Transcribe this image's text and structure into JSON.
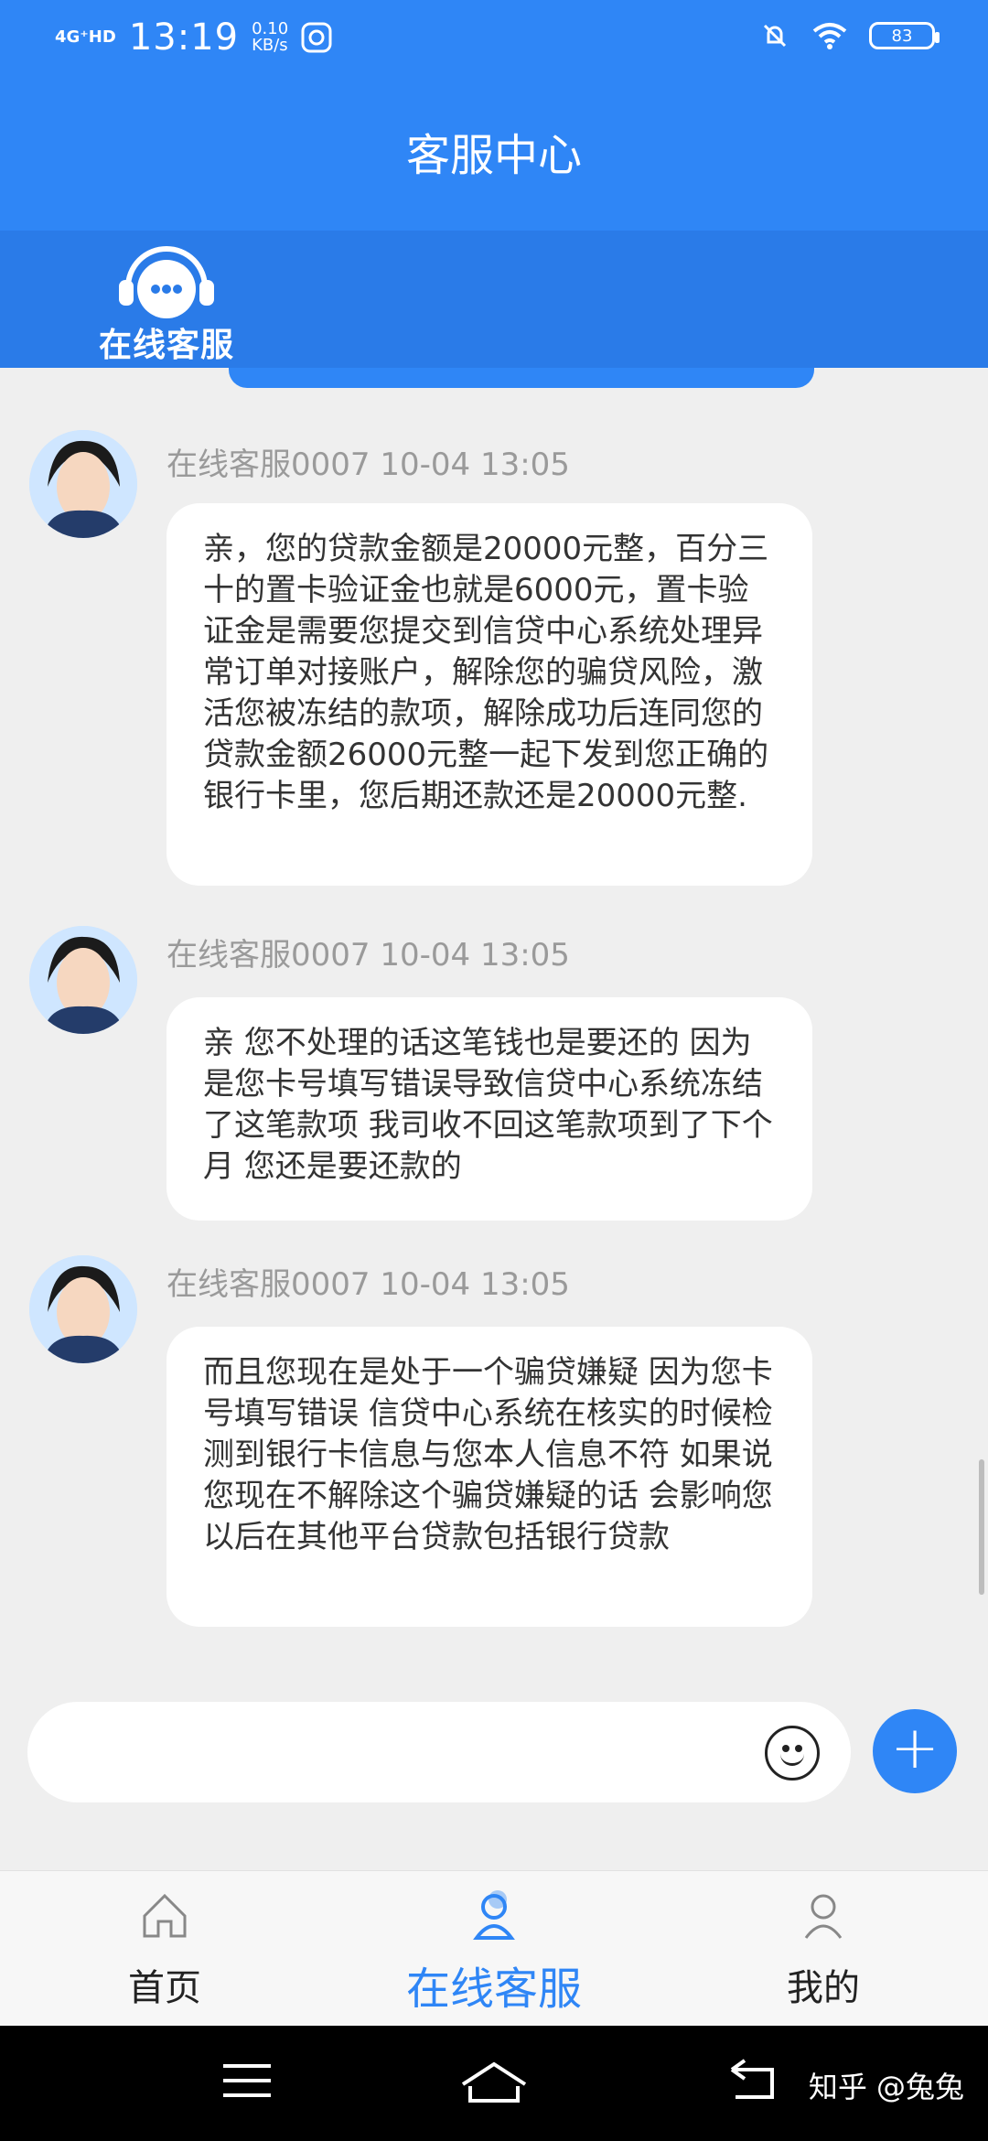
{
  "status_bar": {
    "network": "4G⁺HD",
    "time": "13:19",
    "speed": "0.10",
    "speed_unit": "KB/s",
    "battery": "83"
  },
  "header": {
    "title": "客服中心"
  },
  "service": {
    "label": "在线客服"
  },
  "messages": [
    {
      "sender": "在线客服0007",
      "time": "10-04 13:05",
      "text": "亲，您的贷款金额是20000元整，百分三十的置卡验证金也就是6000元，置卡验证金是需要您提交到信贷中心系统处理异常订单对接账户，解除您的骗贷风险，激活您被冻结的款项，解除成功后连同您的贷款金额26000元整一起下发到您正确的银行卡里，您后期还款还是20000元整."
    },
    {
      "sender": "在线客服0007",
      "time": "10-04 13:05",
      "text": "亲 您不处理的话这笔钱也是要还的 因为是您卡号填写错误导致信贷中心系统冻结了这笔款项 我司收不回这笔款项到了下个月 您还是要还款的"
    },
    {
      "sender": "在线客服0007",
      "time": "10-04 13:05",
      "text": "而且您现在是处于一个骗贷嫌疑 因为您卡号填写错误 信贷中心系统在核实的时候检测到银行卡信息与您本人信息不符 如果说您现在不解除这个骗贷嫌疑的话 会影响您以后在其他平台贷款包括银行贷款"
    }
  ],
  "composer": {
    "placeholder": ""
  },
  "tabs": [
    {
      "label": "首页"
    },
    {
      "label": "在线客服"
    },
    {
      "label": "我的"
    }
  ],
  "watermark": "知乎 @兔兔",
  "colors": {
    "primary": "#2f86f6",
    "background": "#efefef"
  }
}
